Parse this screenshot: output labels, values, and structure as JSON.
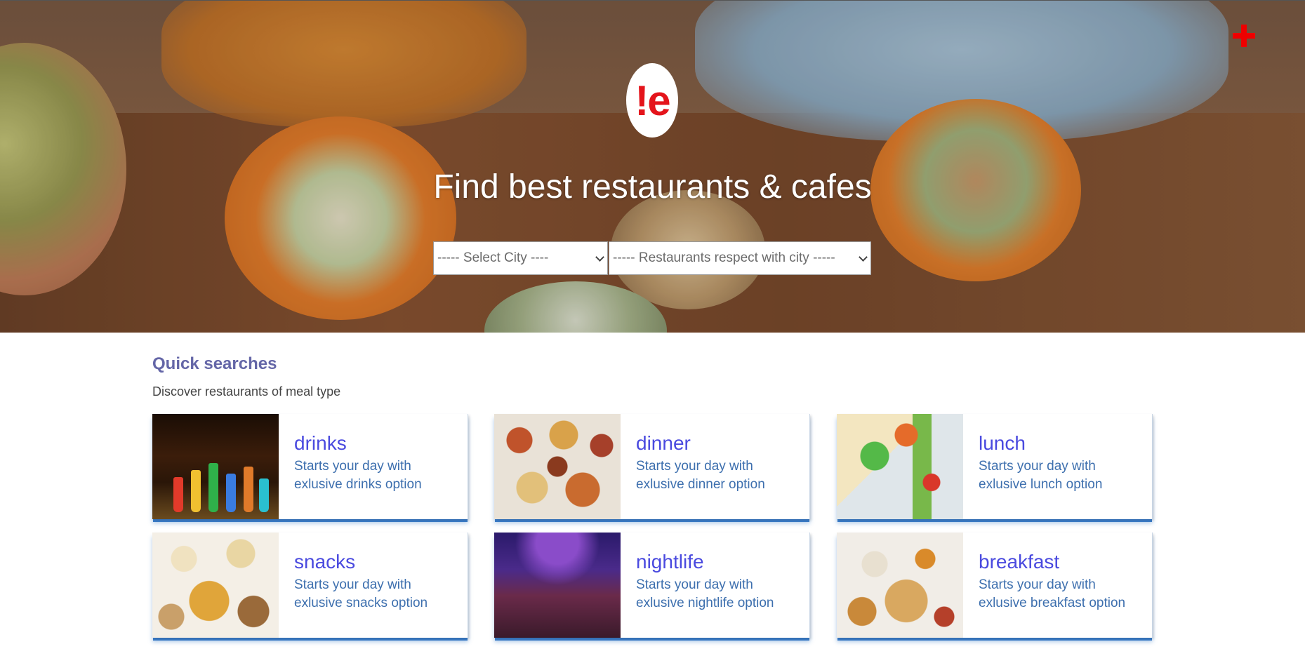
{
  "hero": {
    "logo_text": "!e",
    "title": "Find best restaurants & cafes",
    "city_select": {
      "selected": "----- Select City ----"
    },
    "restaurant_select": {
      "selected": "----- Restaurants respect with city -----"
    }
  },
  "quick_searches": {
    "title": "Quick searches",
    "subtitle": "Discover restaurants of meal type",
    "cards": [
      {
        "name": "drinks",
        "line1": "Starts your day with",
        "line2": "exlusive drinks option"
      },
      {
        "name": "dinner",
        "line1": "Starts your day with",
        "line2": "exlusive dinner option"
      },
      {
        "name": "lunch",
        "line1": "Starts your day with",
        "line2": "exlusive lunch option"
      },
      {
        "name": "snacks",
        "line1": "Starts your day with",
        "line2": "exlusive snacks option"
      },
      {
        "name": "nightlife",
        "line1": "Starts your day with",
        "line2": "exlusive nightlife option"
      },
      {
        "name": "breakfast",
        "line1": "Starts your day with",
        "line2": "exlusive breakfast option"
      }
    ]
  },
  "colors": {
    "accent_red": "#ee0000",
    "heading_purple": "#6466a7",
    "card_title_blue": "#4a4adf",
    "card_text_blue": "#3d6fae",
    "card_underline": "#3b7cc8"
  }
}
